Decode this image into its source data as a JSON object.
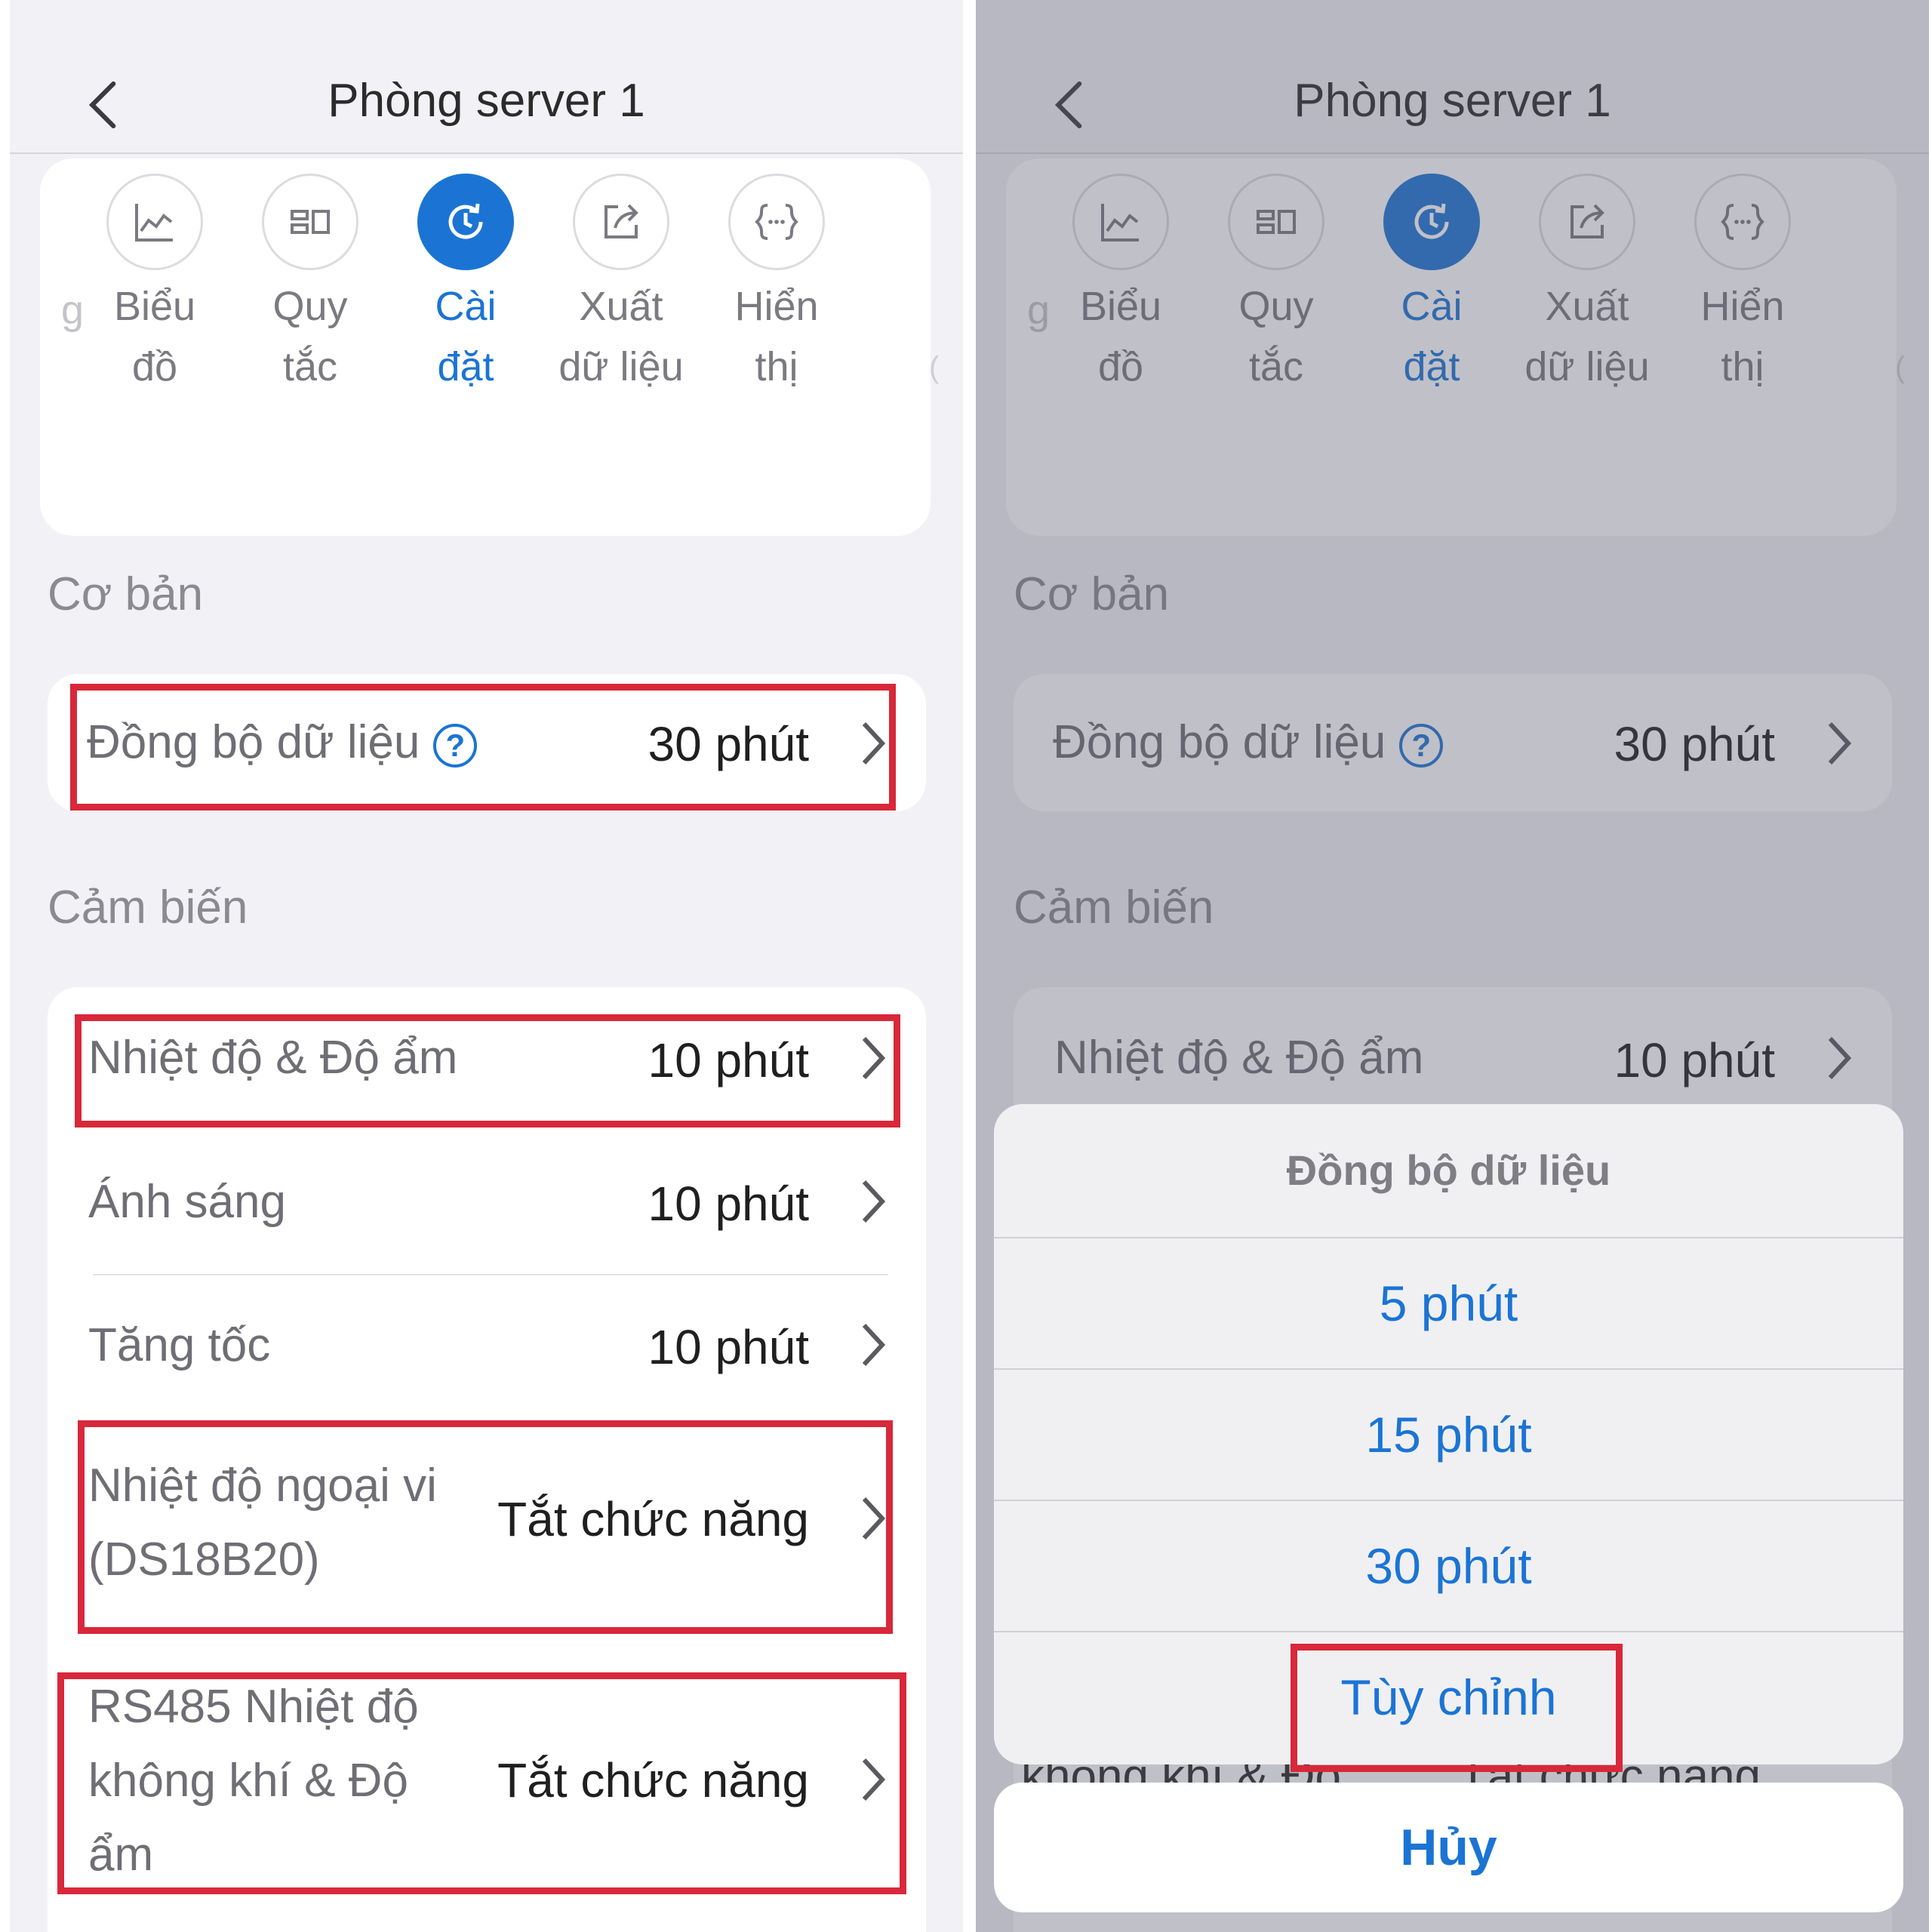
{
  "header": {
    "title": "Phòng server 1"
  },
  "tabs": {
    "partial_left": "g",
    "partial_right": "(",
    "items": [
      {
        "line1": "Biểu",
        "line2": "đồ",
        "icon": "chart-icon"
      },
      {
        "line1": "Quy",
        "line2": "tắc",
        "icon": "rules-icon"
      },
      {
        "line1": "Cài",
        "line2": "đặt",
        "icon": "settings-icon"
      },
      {
        "line1": "Xuất",
        "line2": "dữ liệu",
        "icon": "export-icon"
      },
      {
        "line1": "Hiển",
        "line2": "thị",
        "icon": "code-icon"
      }
    ]
  },
  "basic": {
    "title": "Cơ bản",
    "sync": {
      "label": "Đồng bộ dữ liệu",
      "help": "?",
      "value": "30 phút"
    }
  },
  "sensors": {
    "title": "Cảm biến",
    "items": [
      {
        "label": "Nhiệt độ & Độ ẩm",
        "value": "10 phút"
      },
      {
        "label": "Ánh sáng",
        "value": "10 phút"
      },
      {
        "label": "Tăng tốc",
        "value": "10 phút"
      },
      {
        "label_line1": "Nhiệt độ ngoại vi",
        "label_line2": "(DS18B20)",
        "value": "Tắt chức năng"
      },
      {
        "label_line1": "RS485 Nhiệt độ",
        "label_line2": "không khí & Độ",
        "label_line3": "ẩm",
        "value": "Tắt chức năng"
      }
    ]
  },
  "sheet": {
    "title": "Đồng bộ dữ liệu",
    "options": [
      "5 phút",
      "15 phút",
      "30 phút",
      "Tùy chỉnh"
    ],
    "cancel": "Hủy",
    "peek_label": "không khí & Độ",
    "peek_value": "Tắt chức năng"
  },
  "colors": {
    "accent": "#1b74d4",
    "highlight": "#d8283a"
  }
}
